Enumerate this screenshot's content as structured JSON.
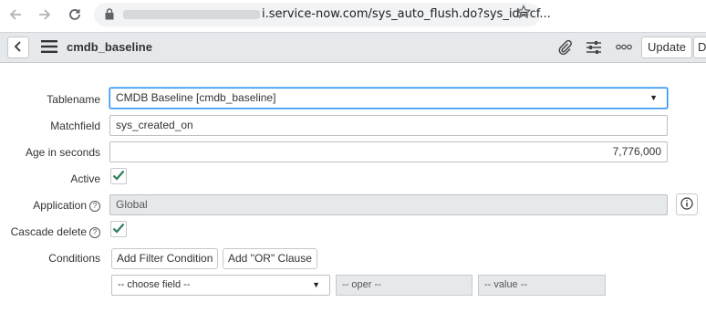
{
  "browser": {
    "url_host": "i.service-now.com",
    "url_path": "/sys_auto_flush.do?sys_id=cf..."
  },
  "header": {
    "title": "cmdb_baseline",
    "update_label": "Update",
    "extra_label": "D"
  },
  "form": {
    "tablename": {
      "label": "Tablename",
      "value": "CMDB Baseline [cmdb_baseline]"
    },
    "matchfield": {
      "label": "Matchfield",
      "value": "sys_created_on"
    },
    "age": {
      "label": "Age in seconds",
      "value": "7,776,000"
    },
    "active": {
      "label": "Active",
      "checked": true
    },
    "application": {
      "label": "Application",
      "value": "Global"
    },
    "cascade_delete": {
      "label": "Cascade delete",
      "checked": true
    },
    "conditions": {
      "label": "Conditions",
      "add_filter_label": "Add Filter Condition",
      "add_or_label": "Add \"OR\" Clause",
      "choose_field": "-- choose field --",
      "oper": "-- oper --",
      "value": "-- value --"
    }
  },
  "icons": [
    "back-icon",
    "forward-icon",
    "reload-icon",
    "lock-icon",
    "star-icon",
    "chevron-left-icon",
    "hamburger-icon",
    "paperclip-icon",
    "sliders-icon",
    "more-icon",
    "checkmark-icon",
    "help-icon",
    "info-icon",
    "dropdown-caret-icon"
  ],
  "colors": {
    "accent": "#278efc",
    "check": "#2e7d5b",
    "header_bg": "#e6e9eb"
  }
}
